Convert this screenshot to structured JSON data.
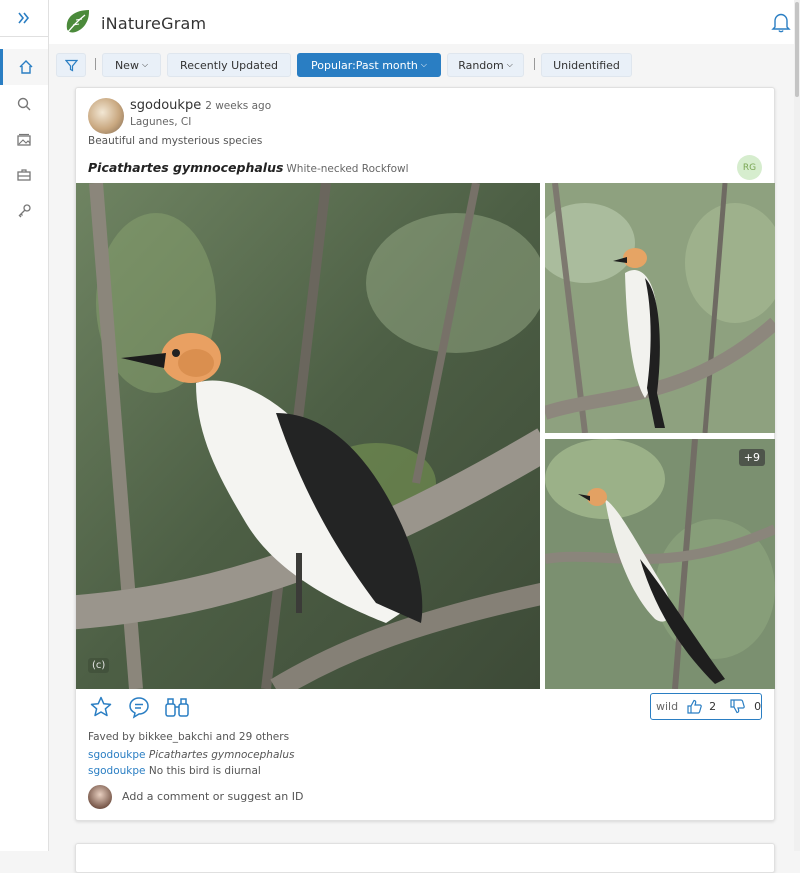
{
  "app": {
    "title": "iNatureGram"
  },
  "sidebar": {
    "items": [
      {
        "icon": "home-icon"
      },
      {
        "icon": "search-icon"
      },
      {
        "icon": "gallery-icon"
      },
      {
        "icon": "briefcase-icon"
      },
      {
        "icon": "key-icon"
      }
    ]
  },
  "filters": {
    "new_label": "New",
    "recent_label": "Recently Updated",
    "popular_label": "Popular:Past month",
    "random_label": "Random",
    "unidentified_label": "Unidentified"
  },
  "post": {
    "username": "sgodoukpe",
    "time_ago": "2 weeks ago",
    "location": "Lagunes, CI",
    "description": "Beautiful and mysterious species",
    "scientific_name": "Picathartes gymnocephalus",
    "common_name": "White-necked Rockfowl",
    "quality_badge": "RG",
    "copyright": "(c)",
    "more_photos": "+9",
    "wild_label": "wild",
    "agree_count": "2",
    "disagree_count": "0",
    "faved_text": "Faved by bikkee_bakchi and 29 others",
    "comments": [
      {
        "user": "sgodoukpe",
        "text": "Picathartes gymnocephalus",
        "italic": true
      },
      {
        "user": "sgodoukpe",
        "text": "No this bird is diurnal",
        "italic": false
      }
    ],
    "comment_placeholder": "Add a comment or suggest an ID"
  },
  "colors": {
    "accent": "#2a7ec3",
    "logo_green": "#4b8a3b",
    "rg_bg": "#d6edce"
  }
}
